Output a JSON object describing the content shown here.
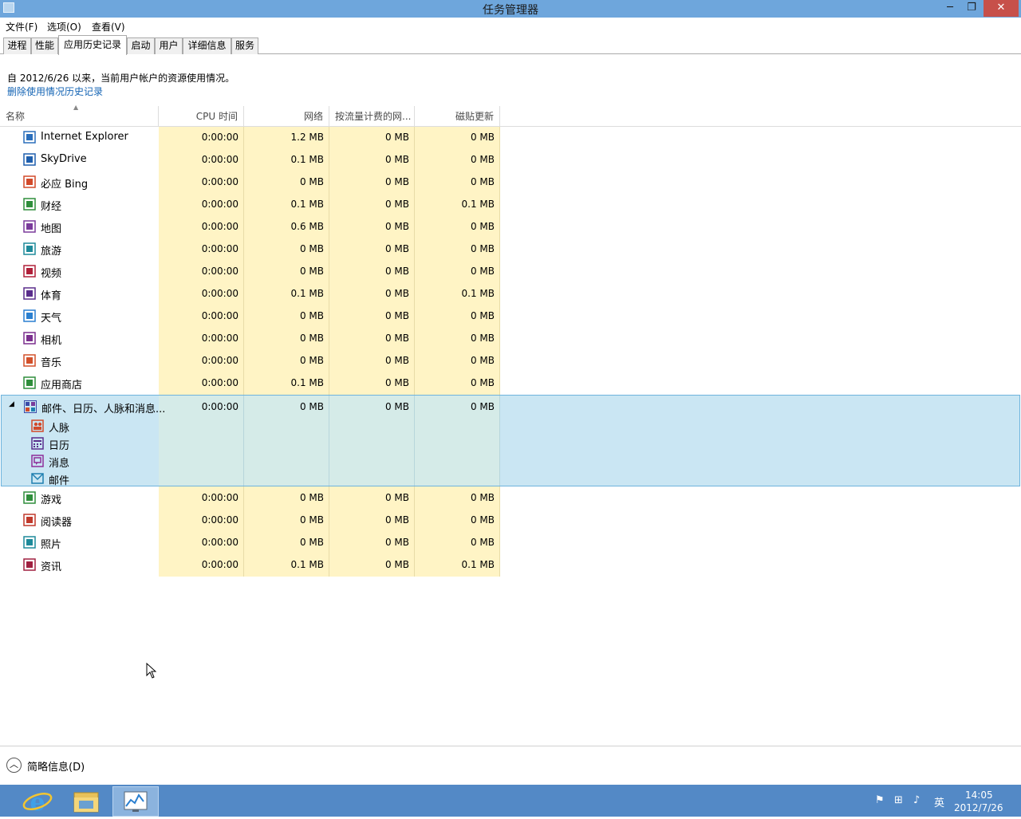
{
  "window": {
    "title": "任务管理器",
    "minimize": "─",
    "restore": "❐",
    "close": "✕"
  },
  "menu": [
    "文件(F)",
    "选项(O)",
    "查看(V)"
  ],
  "tabs": [
    "进程",
    "性能",
    "应用历史记录",
    "启动",
    "用户",
    "详细信息",
    "服务"
  ],
  "active_tab": "应用历史记录",
  "info_text": "自 2012/6/26 以来，当前用户帐户的资源使用情况。",
  "delete_link": "删除使用情况历史记录",
  "columns": {
    "name": "名称",
    "cpu": "CPU 时间",
    "network": "网络",
    "metered": "按流量计费的网...",
    "tile": "磁贴更新"
  },
  "rows_top": [
    {
      "name": "Internet Explorer",
      "icon": "ie-icon",
      "color": "#2a6ebb",
      "cpu": "0:00:00",
      "network": "1.2 MB",
      "metered": "0 MB",
      "tile": "0 MB"
    },
    {
      "name": "SkyDrive",
      "icon": "skydrive-icon",
      "color": "#1f5fad",
      "cpu": "0:00:00",
      "network": "0.1 MB",
      "metered": "0 MB",
      "tile": "0 MB"
    },
    {
      "name": "必应 Bing",
      "icon": "bing-icon",
      "color": "#d24a2a",
      "cpu": "0:00:00",
      "network": "0 MB",
      "metered": "0 MB",
      "tile": "0 MB"
    },
    {
      "name": "财经",
      "icon": "finance-icon",
      "color": "#2f8e3b",
      "cpu": "0:00:00",
      "network": "0.1 MB",
      "metered": "0 MB",
      "tile": "0.1 MB"
    },
    {
      "name": "地图",
      "icon": "maps-icon",
      "color": "#7a3b9b",
      "cpu": "0:00:00",
      "network": "0.6 MB",
      "metered": "0 MB",
      "tile": "0 MB"
    },
    {
      "name": "旅游",
      "icon": "travel-icon",
      "color": "#1e8a9a",
      "cpu": "0:00:00",
      "network": "0 MB",
      "metered": "0 MB",
      "tile": "0 MB"
    },
    {
      "name": "视频",
      "icon": "video-icon",
      "color": "#b0203a",
      "cpu": "0:00:00",
      "network": "0 MB",
      "metered": "0 MB",
      "tile": "0 MB"
    },
    {
      "name": "体育",
      "icon": "sports-icon",
      "color": "#5a2d8c",
      "cpu": "0:00:00",
      "network": "0.1 MB",
      "metered": "0 MB",
      "tile": "0.1 MB"
    },
    {
      "name": "天气",
      "icon": "weather-icon",
      "color": "#2a7fd0",
      "cpu": "0:00:00",
      "network": "0 MB",
      "metered": "0 MB",
      "tile": "0 MB"
    },
    {
      "name": "相机",
      "icon": "camera-icon",
      "color": "#7b2f8e",
      "cpu": "0:00:00",
      "network": "0 MB",
      "metered": "0 MB",
      "tile": "0 MB"
    },
    {
      "name": "音乐",
      "icon": "music-icon",
      "color": "#d2502a",
      "cpu": "0:00:00",
      "network": "0 MB",
      "metered": "0 MB",
      "tile": "0 MB"
    },
    {
      "name": "应用商店",
      "icon": "store-icon",
      "color": "#2f8e3b",
      "cpu": "0:00:00",
      "network": "0.1 MB",
      "metered": "0 MB",
      "tile": "0 MB"
    }
  ],
  "group": {
    "name": "邮件、日历、人脉和消息...",
    "icon": "mail-calendar-icon",
    "color": "#3a4aa8",
    "cpu": "0:00:00",
    "network": "0 MB",
    "metered": "0 MB",
    "tile": "0 MB",
    "expander": "◢",
    "children": [
      {
        "name": "人脉",
        "icon": "people-icon",
        "color": "#d24a2a"
      },
      {
        "name": "日历",
        "icon": "calendar-icon",
        "color": "#5a2d8c"
      },
      {
        "name": "消息",
        "icon": "messaging-icon",
        "color": "#8e2f9a"
      },
      {
        "name": "邮件",
        "icon": "mail-icon",
        "color": "#1e7fb0"
      }
    ]
  },
  "rows_bottom": [
    {
      "name": "游戏",
      "icon": "games-icon",
      "color": "#2f8e3b",
      "cpu": "0:00:00",
      "network": "0 MB",
      "metered": "0 MB",
      "tile": "0 MB"
    },
    {
      "name": "阅读器",
      "icon": "reader-icon",
      "color": "#c0392b",
      "cpu": "0:00:00",
      "network": "0 MB",
      "metered": "0 MB",
      "tile": "0 MB"
    },
    {
      "name": "照片",
      "icon": "photos-icon",
      "color": "#1e8a9a",
      "cpu": "0:00:00",
      "network": "0 MB",
      "metered": "0 MB",
      "tile": "0 MB"
    },
    {
      "name": "资讯",
      "icon": "news-icon",
      "color": "#a02040",
      "cpu": "0:00:00",
      "network": "0.1 MB",
      "metered": "0 MB",
      "tile": "0.1 MB"
    }
  ],
  "footer": {
    "label": "简略信息(D)"
  },
  "taskbar": {
    "ime": "英",
    "time": "14:05",
    "date": "2012/7/26"
  }
}
